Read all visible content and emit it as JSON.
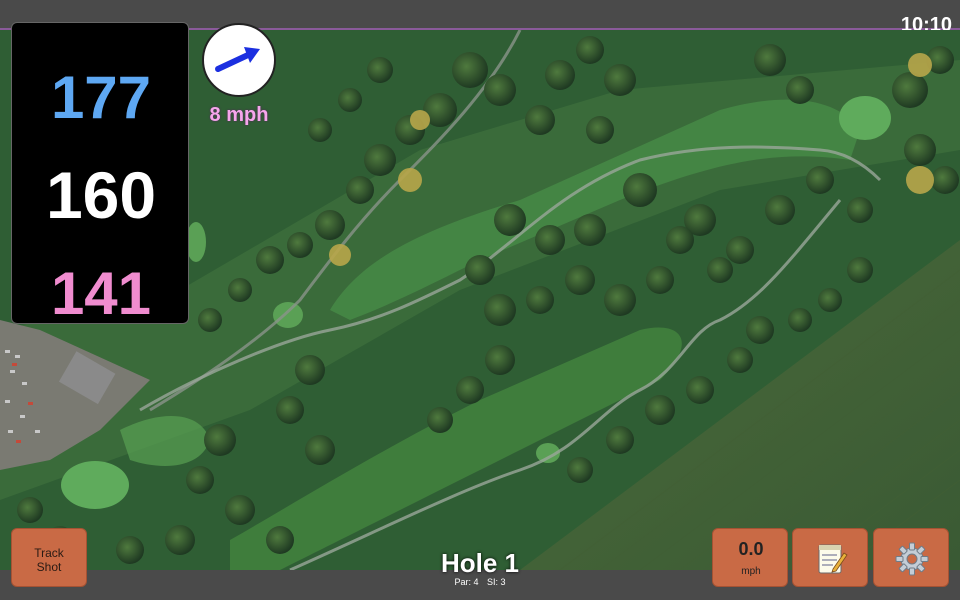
{
  "status": {
    "clock": "10:10"
  },
  "distances": {
    "back": "177",
    "middle": "160",
    "front": "141"
  },
  "wind": {
    "speed_label": "8 mph",
    "icon": "wind-direction-arrow-icon"
  },
  "hole": {
    "title": "Hole 1",
    "par_label": "Par: 4",
    "si_label": "SI: 3"
  },
  "buttons": {
    "track_shot_line1": "Track",
    "track_shot_line2": "Shot",
    "speed_value": "0.0",
    "speed_unit": "mph",
    "notes_icon": "notepad-icon",
    "settings_icon": "gear-icon"
  },
  "colors": {
    "back": "#5ea8f3",
    "middle": "#ffffff",
    "front": "#f08ccf",
    "wind": "#f6a6ec",
    "button": "#c96a45",
    "accent_line": "#8a5a9a"
  }
}
